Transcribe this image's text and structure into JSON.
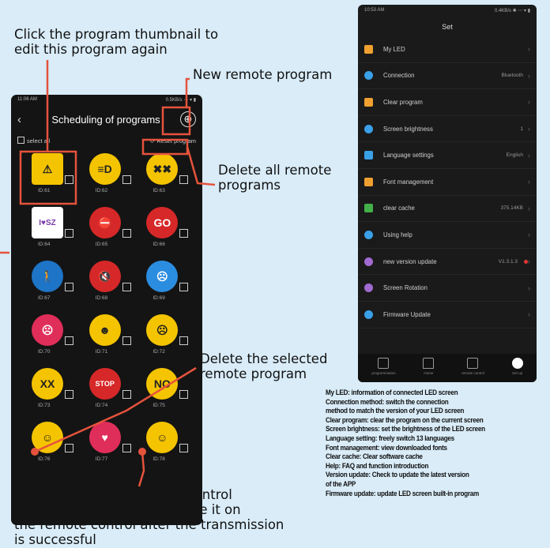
{
  "callouts": {
    "thumbnail": "Click the program thumbnail to\nedit this program again",
    "new_remote": "New remote program",
    "delete_all": "Delete all remote\nprograms",
    "delete_selected": "Delete the selected\nremote program",
    "send_selected": "Send the selected remote control\nprogram, you can click to use it on\nthe remote control after the transmission\nis successful"
  },
  "left_phone": {
    "status_time": "11:06 AM",
    "status_right": "0.5KB/s  ⋯  ▾  ▮",
    "back_icon": "‹",
    "title": "Scheduling of programs",
    "add_icon": "⊕",
    "select_all": "select all",
    "reset_program": "Reset program",
    "programs": [
      {
        "id": "ID:61",
        "icon": "construction-sign-icon",
        "bg": "#f5c400",
        "glyph": "⚠"
      },
      {
        "id": "ID:62",
        "icon": "emoji-face-icon",
        "bg": "#f5c400",
        "glyph": "≡D"
      },
      {
        "id": "ID:63",
        "icon": "emoji-face-icon",
        "bg": "#f5c400",
        "glyph": "✖✖"
      },
      {
        "id": "ID:64",
        "icon": "i-love-sz-icon",
        "bg": "#ffffff",
        "glyph": "I♥SZ"
      },
      {
        "id": "ID:65",
        "icon": "no-entry-icon",
        "bg": "#d62828",
        "glyph": "⛔"
      },
      {
        "id": "ID:66",
        "icon": "go-sign-icon",
        "bg": "#d62828",
        "glyph": "GO"
      },
      {
        "id": "ID:67",
        "icon": "pedestrian-icon",
        "bg": "#1e74c7",
        "glyph": "🚶"
      },
      {
        "id": "ID:68",
        "icon": "no-sound-icon",
        "bg": "#d62828",
        "glyph": "🔇"
      },
      {
        "id": "ID:69",
        "icon": "grimace-face-icon",
        "bg": "#2b8de0",
        "glyph": "☹"
      },
      {
        "id": "ID:70",
        "icon": "sad-face-icon",
        "bg": "#e02e5a",
        "glyph": "☹"
      },
      {
        "id": "ID:71",
        "icon": "cool-face-icon",
        "bg": "#f5c400",
        "glyph": "☻"
      },
      {
        "id": "ID:72",
        "icon": "shocked-face-icon",
        "bg": "#f5c400",
        "glyph": "☹"
      },
      {
        "id": "ID:73",
        "icon": "dizzy-face-icon",
        "bg": "#f5c400",
        "glyph": "XX"
      },
      {
        "id": "ID:74",
        "icon": "stop-sign-icon",
        "bg": "#d62828",
        "glyph": "STOP"
      },
      {
        "id": "ID:75",
        "icon": "no-face-icon",
        "bg": "#f5c400",
        "glyph": "NO"
      },
      {
        "id": "ID:76",
        "icon": "wink-face-icon",
        "bg": "#f5c400",
        "glyph": "☺"
      },
      {
        "id": "ID:77",
        "icon": "heart-icon",
        "bg": "#e02e5a",
        "glyph": "♥"
      },
      {
        "id": "ID:78",
        "icon": "smile-face-icon",
        "bg": "#f5c400",
        "glyph": "☺"
      }
    ]
  },
  "right_phone": {
    "status_time": "10:53 AM",
    "status_right": "0.4KB/s  ✱  ⋯  ▾  ▮",
    "title": "Set",
    "settings": [
      {
        "label": "My LED",
        "value": "",
        "icon": "person-icon",
        "color": "#f0a030"
      },
      {
        "label": "Connection",
        "value": "Bluetooth",
        "icon": "bluetooth-icon",
        "color": "#3aa0e8"
      },
      {
        "label": "Clear program",
        "value": "",
        "icon": "trash-icon",
        "color": "#f0a030"
      },
      {
        "label": "Screen brightness",
        "value": "1",
        "icon": "brightness-icon",
        "color": "#3aa0e8"
      },
      {
        "label": "Language settings",
        "value": "English",
        "icon": "language-icon",
        "color": "#3aa0e8"
      },
      {
        "label": "Font management",
        "value": "",
        "icon": "font-icon",
        "color": "#f0a030"
      },
      {
        "label": "clear cache",
        "value": "375.14KB",
        "icon": "cache-icon",
        "color": "#43b04a"
      },
      {
        "label": "Using help",
        "value": "",
        "icon": "help-icon",
        "color": "#3aa0e8"
      },
      {
        "label": "new version update",
        "value": "V1.3.1.3",
        "icon": "update-icon",
        "color": "#a06ad0",
        "dot": true
      },
      {
        "label": "Screen Rotation",
        "value": "",
        "icon": "rotation-icon",
        "color": "#a06ad0"
      },
      {
        "label": "Firmware Update",
        "value": "",
        "icon": "firmware-icon",
        "color": "#3aa0e8"
      }
    ],
    "tabs": [
      {
        "label": "programmation",
        "icon": "program-list-icon"
      },
      {
        "label": "Home",
        "icon": "home-icon"
      },
      {
        "label": "remote control",
        "icon": "remote-icon"
      },
      {
        "label": "Set up",
        "icon": "gear-icon",
        "active": true
      }
    ]
  },
  "descriptions": [
    "My LED: information of connected LED screen",
    "Connection method: switch the connection",
    "method to match the version of your LED screen",
    "Clear program: clear the program on the current screen",
    "Screen brightness: set the brightness of the LED screen",
    "Language setting: freely switch 13 languages",
    "Font management: view downloaded fonts",
    "Clear cache: Clear software cache",
    "Help: FAQ and function introduction",
    "Version update: Check to update the latest version",
    " of the APP",
    "Firmware update: update LED screen built-in program"
  ],
  "colors": {
    "background": "#d9ecf8",
    "callout_line": "#e5533c",
    "phone_bg": "#141414"
  }
}
